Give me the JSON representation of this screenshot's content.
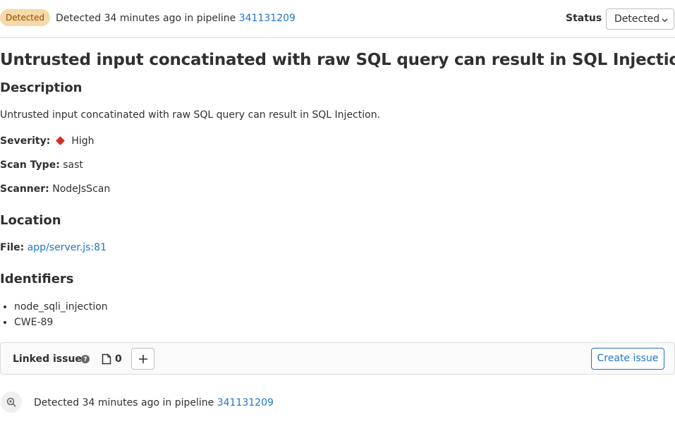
{
  "header": {
    "badge": "Detected",
    "detected_prefix": "Detected 34 minutes ago in pipeline ",
    "pipeline_id": "341131209",
    "status_label": "Status",
    "status_value": "Detected"
  },
  "title": "Untrusted input concatinated with raw SQL query can result in SQL Injection.",
  "description": {
    "heading": "Description",
    "text": "Untrusted input concatinated with raw SQL query can result in SQL Injection."
  },
  "details": {
    "severity_label": "Severity:",
    "severity_value": "High",
    "severity_color": "#d22c1e",
    "scan_type_label": "Scan Type:",
    "scan_type_value": "sast",
    "scanner_label": "Scanner:",
    "scanner_value": "NodeJsScan"
  },
  "location": {
    "heading": "Location",
    "file_label": "File:",
    "file_link": "app/server.js:81"
  },
  "identifiers": {
    "heading": "Identifiers",
    "items": [
      "node_sqli_injection",
      "CWE-89"
    ]
  },
  "linked_issues": {
    "title": "Linked issues",
    "count": "0",
    "create_label": "Create issue",
    "icons": [
      "question-circle-icon",
      "issues-icon",
      "plus-icon"
    ]
  },
  "history": {
    "prefix": "Detected 34 minutes ago in pipeline ",
    "pipeline_id": "341131209",
    "icon": "search-dot-icon"
  },
  "colors": {
    "link": "#1f75cb",
    "badge_bg": "#f5d9a8",
    "badge_text": "#8f4700"
  }
}
